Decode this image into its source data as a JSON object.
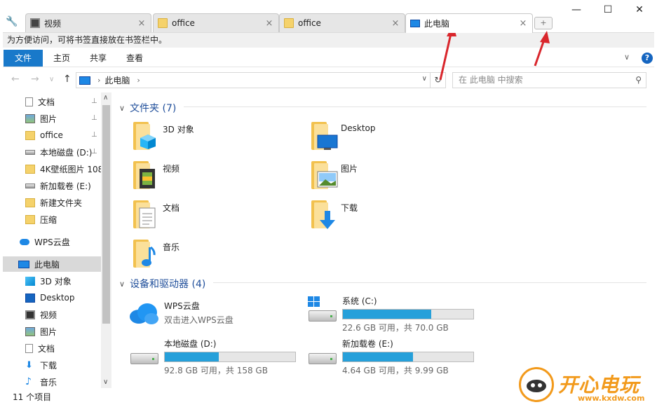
{
  "tabs": [
    {
      "label": "视频",
      "active": false
    },
    {
      "label": "office",
      "active": false
    },
    {
      "label": "office",
      "active": false
    },
    {
      "label": "此电脑",
      "active": true
    }
  ],
  "tab_close": "×",
  "new_tab": "+",
  "window": {
    "minimize": "—",
    "maximize": "☐",
    "close": "✕"
  },
  "bookmark_hint": "为方便访问，可将书签直接放在书签栏中。",
  "ribbon": {
    "file": "文件",
    "home": "主页",
    "share": "共享",
    "view": "查看",
    "expand": "∨",
    "help": "?"
  },
  "address": {
    "location": "此电脑",
    "separator": "›",
    "dropdown": "∨",
    "refresh": "↻"
  },
  "search": {
    "placeholder": "在 此电脑 中搜索",
    "icon": "⚲"
  },
  "nav": {
    "back": "←",
    "forward": "→",
    "history": "∨",
    "up": "↑"
  },
  "sidebar": [
    {
      "label": "文档",
      "icon": "document-icon",
      "pinned": true
    },
    {
      "label": "图片",
      "icon": "pictures-icon",
      "pinned": true
    },
    {
      "label": "office",
      "icon": "folder-icon",
      "pinned": true
    },
    {
      "label": "本地磁盘 (D:)",
      "icon": "drive-icon",
      "pinned": true
    },
    {
      "label": "4K壁纸图片 108",
      "icon": "folder-icon",
      "pinned": false
    },
    {
      "label": "新加载卷 (E:)",
      "icon": "drive-icon",
      "pinned": false
    },
    {
      "label": "新建文件夹",
      "icon": "folder-icon",
      "pinned": false
    },
    {
      "label": "压缩",
      "icon": "folder-icon",
      "pinned": false
    },
    {
      "label": "WPS云盘",
      "icon": "cloud-icon",
      "pinned": false
    },
    {
      "label": "此电脑",
      "icon": "computer-icon",
      "pinned": false,
      "selected": true
    },
    {
      "label": "3D 对象",
      "icon": "cube-icon",
      "pinned": false
    },
    {
      "label": "Desktop",
      "icon": "desktop-icon",
      "pinned": false
    },
    {
      "label": "视频",
      "icon": "video-icon",
      "pinned": false
    },
    {
      "label": "图片",
      "icon": "pictures-icon",
      "pinned": false
    },
    {
      "label": "文档",
      "icon": "document-icon",
      "pinned": false
    },
    {
      "label": "下载",
      "icon": "download-icon",
      "pinned": false
    },
    {
      "label": "音乐",
      "icon": "music-icon",
      "pinned": false
    }
  ],
  "pin_glyph": "📌",
  "folders_header": "文件夹 (7)",
  "folders": [
    {
      "label": "3D 对象",
      "overlay": "cube"
    },
    {
      "label": "Desktop",
      "overlay": "desktop"
    },
    {
      "label": "视频",
      "overlay": "film"
    },
    {
      "label": "图片",
      "overlay": "picture"
    },
    {
      "label": "文档",
      "overlay": "document"
    },
    {
      "label": "下载",
      "overlay": "download"
    },
    {
      "label": "音乐",
      "overlay": "music"
    }
  ],
  "devices_header": "设备和驱动器 (4)",
  "wps_cloud": {
    "name": "WPS云盘",
    "subtitle": "双击进入WPS云盘"
  },
  "drives": [
    {
      "name": "系统 (C:)",
      "free": "22.6 GB 可用，共 70.0 GB",
      "used_fraction": 0.677
    },
    {
      "name": "本地磁盘 (D:)",
      "free": "92.8 GB 可用，共 158 GB",
      "used_fraction": 0.413
    },
    {
      "name": "新加载卷 (E:)",
      "free": "4.64 GB 可用，共 9.99 GB",
      "used_fraction": 0.535
    }
  ],
  "status": "11 个项目",
  "watermark": {
    "text": "开心电玩",
    "url": "www.kxdw.com"
  },
  "colors": {
    "accent": "#1979ca",
    "header": "#1f4e9a",
    "bar": "#26a0da",
    "annotation": "#d9262c",
    "watermark": "#f29a1c"
  }
}
